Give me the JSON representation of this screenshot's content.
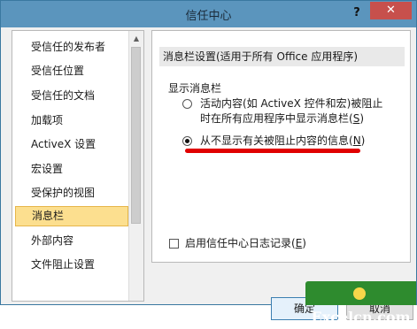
{
  "window": {
    "title": "信任中心",
    "help_glyph": "?",
    "close_glyph": "✕"
  },
  "sidebar": {
    "items": [
      {
        "label": "受信任的发布者",
        "active": false
      },
      {
        "label": "受信任位置",
        "active": false
      },
      {
        "label": "受信任的文档",
        "active": false
      },
      {
        "label": "加载项",
        "active": false
      },
      {
        "label": "ActiveX 设置",
        "active": false
      },
      {
        "label": "宏设置",
        "active": false
      },
      {
        "label": "受保护的视图",
        "active": false
      },
      {
        "label": "消息栏",
        "active": true
      },
      {
        "label": "外部内容",
        "active": false
      },
      {
        "label": "文件阻止设置",
        "active": false
      }
    ]
  },
  "pane": {
    "section_header": "消息栏设置(适用于所有 Office 应用程序)",
    "group_label": "显示消息栏",
    "option1_line1": "活动内容(如 ActiveX 控件和宏)被阻止",
    "option1_line2_prefix": "时在所有应用程序中显示消息栏(",
    "option1_key": "S",
    "option1_suffix": ")",
    "option1_checked": false,
    "option2_prefix": "从不显示有关被阻止内容的信息(",
    "option2_key": "N",
    "option2_suffix": ")",
    "option2_checked": true,
    "checkbox_prefix": "启用信任中心日志记录(",
    "checkbox_key": "E",
    "checkbox_suffix": ")",
    "checkbox_checked": false
  },
  "buttons": {
    "ok": "确定",
    "cancel": "取消"
  },
  "watermark": {
    "text": "Excelcn.com"
  },
  "colors": {
    "titlebar": "#5b95bd",
    "close_button": "#c7504c",
    "active_nav": "#fcdf8f",
    "annotation_underline": "#e00000",
    "watermark": "#2e8b2e"
  }
}
